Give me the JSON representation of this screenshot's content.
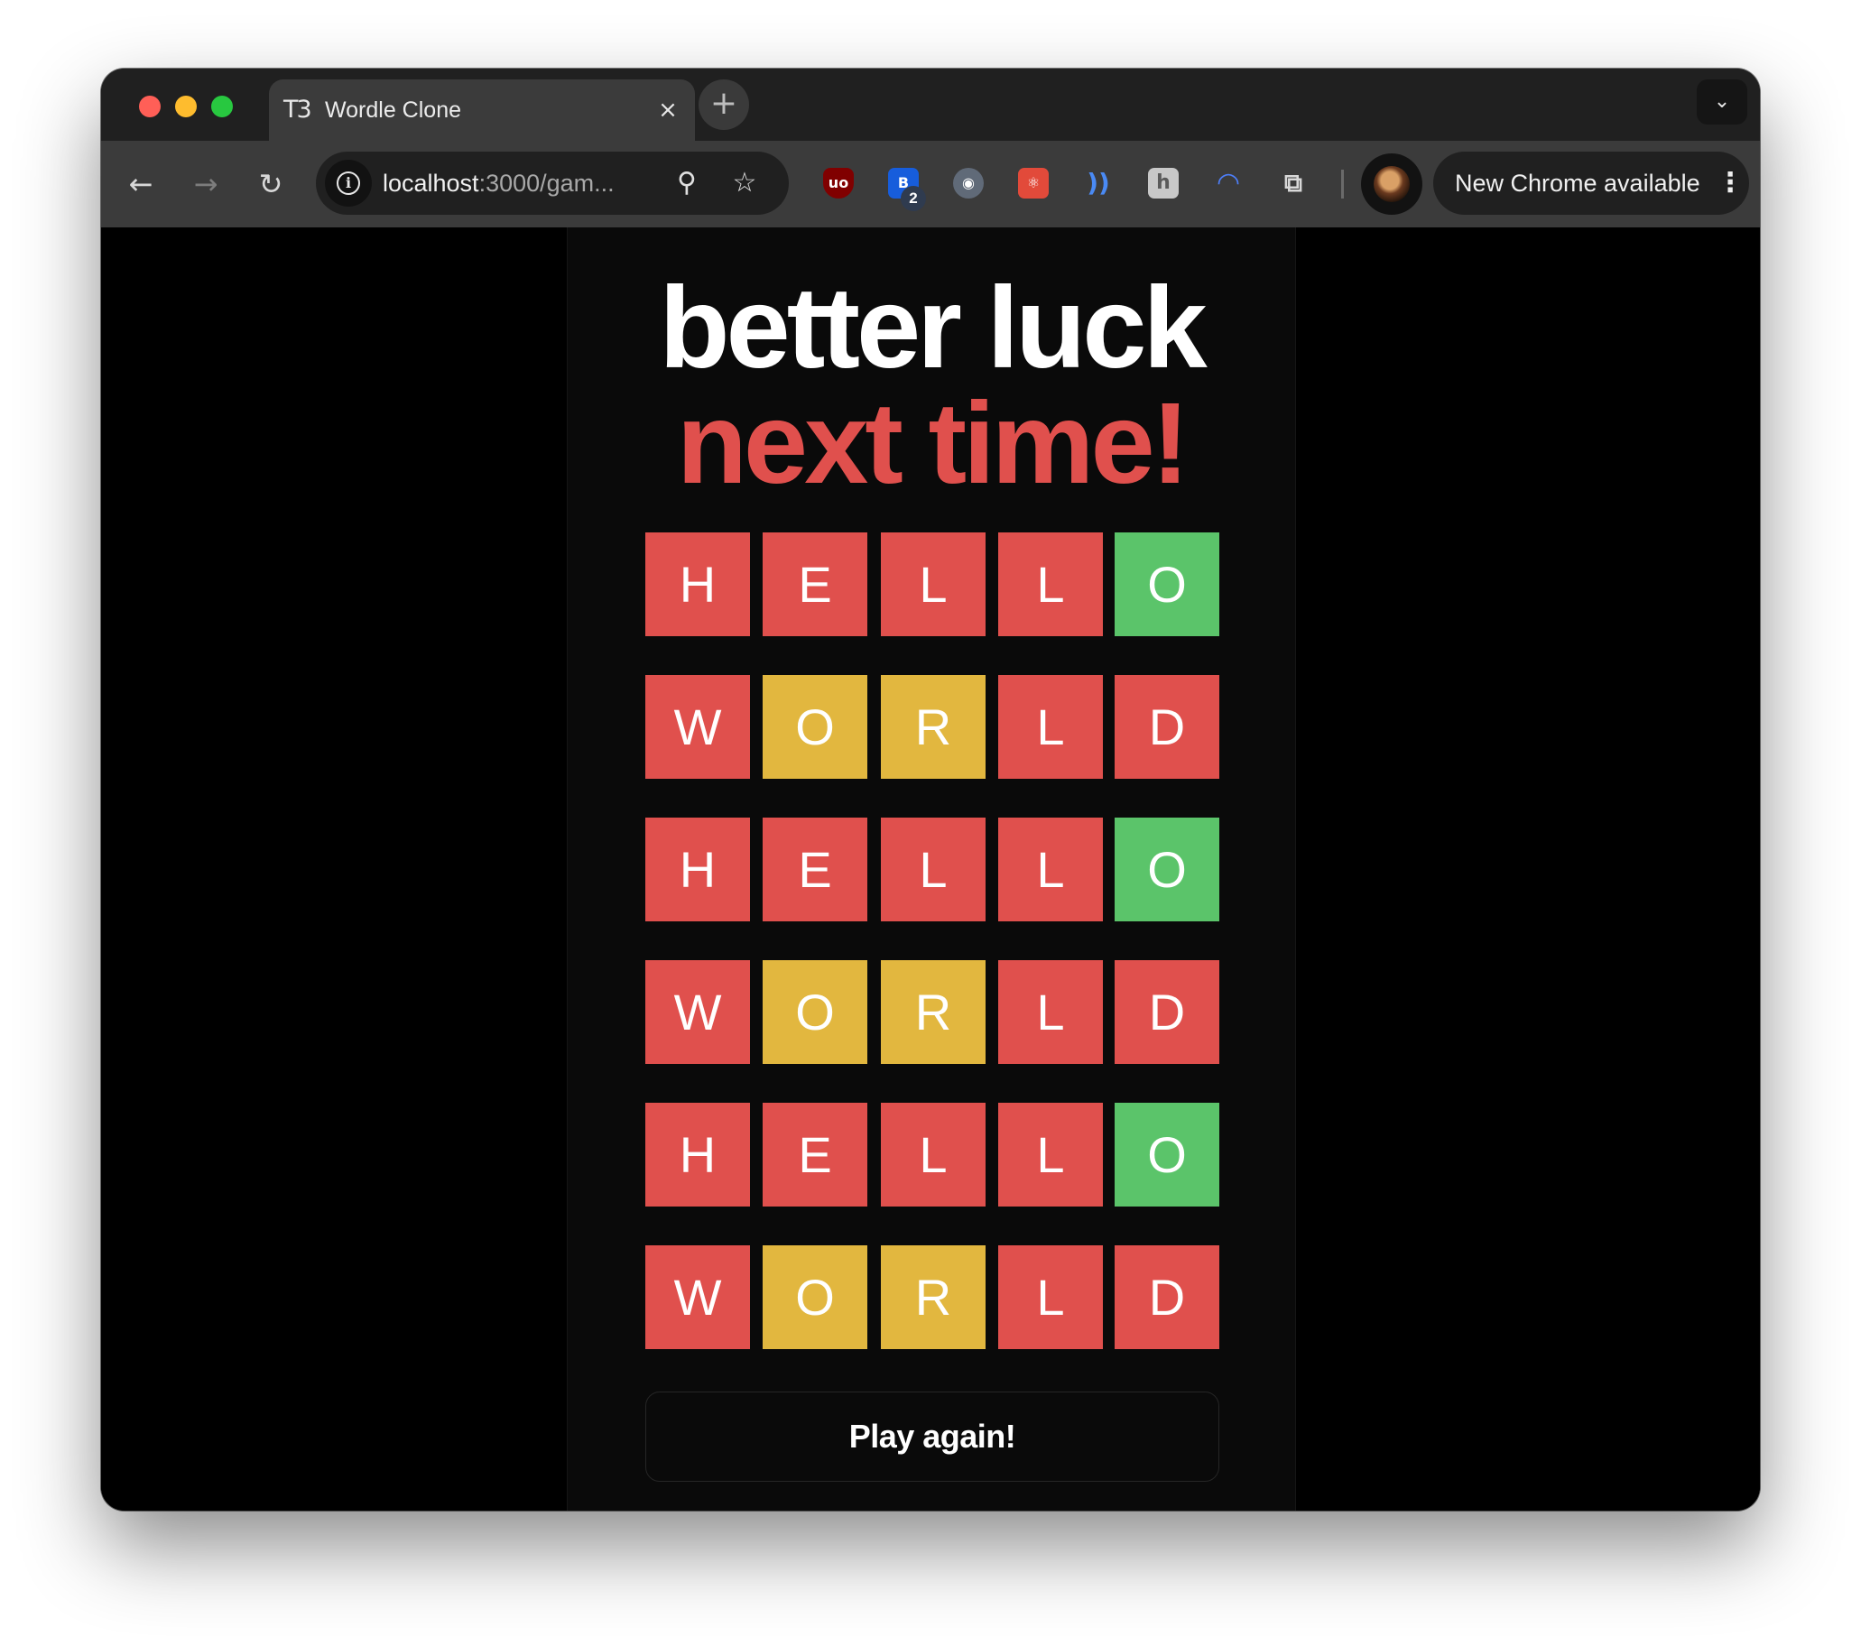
{
  "browser": {
    "tab": {
      "favicon": "T3",
      "title": "Wordle Clone",
      "close_icon": "×"
    },
    "new_tab_icon": "+",
    "tab_search_icon": "⌄",
    "nav": {
      "back_icon": "←",
      "forward_icon": "→",
      "reload_icon": "↻"
    },
    "omnibox": {
      "site_info_icon": "i",
      "url_host": "localhost",
      "url_path": ":3000/gam...",
      "zoom_icon": "⚲",
      "bookmark_icon": "☆"
    },
    "extensions": [
      {
        "name": "ublock-origin-icon",
        "glyph": "uo"
      },
      {
        "name": "bitwarden-icon",
        "glyph": "B",
        "badge": "2"
      },
      {
        "name": "spy-icon",
        "glyph": "◉"
      },
      {
        "name": "react-devtools-icon",
        "glyph": "⚛"
      },
      {
        "name": "wave-icon",
        "glyph": "))"
      },
      {
        "name": "h-extension-icon",
        "glyph": "h"
      },
      {
        "name": "arc-icon",
        "glyph": "◠"
      },
      {
        "name": "puzzle-icon",
        "glyph": "⧉"
      }
    ],
    "update_chip": {
      "label": "New Chrome available",
      "menu_icon": "⋮"
    },
    "colors": {
      "tabstrip": "#202020",
      "toolbar": "#3b3b3b"
    }
  },
  "game": {
    "headline_line1": "better luck",
    "headline_line2": "next time!",
    "rows": [
      [
        {
          "letter": "H",
          "state": "red"
        },
        {
          "letter": "E",
          "state": "red"
        },
        {
          "letter": "L",
          "state": "red"
        },
        {
          "letter": "L",
          "state": "red"
        },
        {
          "letter": "O",
          "state": "green"
        }
      ],
      [
        {
          "letter": "W",
          "state": "red"
        },
        {
          "letter": "O",
          "state": "yellow"
        },
        {
          "letter": "R",
          "state": "yellow"
        },
        {
          "letter": "L",
          "state": "red"
        },
        {
          "letter": "D",
          "state": "red"
        }
      ],
      [
        {
          "letter": "H",
          "state": "red"
        },
        {
          "letter": "E",
          "state": "red"
        },
        {
          "letter": "L",
          "state": "red"
        },
        {
          "letter": "L",
          "state": "red"
        },
        {
          "letter": "O",
          "state": "green"
        }
      ],
      [
        {
          "letter": "W",
          "state": "red"
        },
        {
          "letter": "O",
          "state": "yellow"
        },
        {
          "letter": "R",
          "state": "yellow"
        },
        {
          "letter": "L",
          "state": "red"
        },
        {
          "letter": "D",
          "state": "red"
        }
      ],
      [
        {
          "letter": "H",
          "state": "red"
        },
        {
          "letter": "E",
          "state": "red"
        },
        {
          "letter": "L",
          "state": "red"
        },
        {
          "letter": "L",
          "state": "red"
        },
        {
          "letter": "O",
          "state": "green"
        }
      ],
      [
        {
          "letter": "W",
          "state": "red"
        },
        {
          "letter": "O",
          "state": "yellow"
        },
        {
          "letter": "R",
          "state": "yellow"
        },
        {
          "letter": "L",
          "state": "red"
        },
        {
          "letter": "D",
          "state": "red"
        }
      ]
    ],
    "play_again_label": "Play again!",
    "colors": {
      "red": "#e0504d",
      "yellow": "#e2b73f",
      "green": "#5bc46a"
    }
  }
}
